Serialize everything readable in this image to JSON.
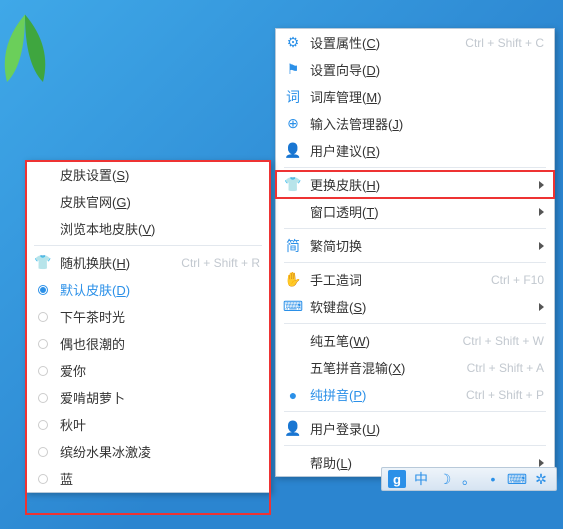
{
  "rightMenu": {
    "groups": [
      [
        {
          "icon": "gear-icon",
          "glyph": "⚙",
          "label": "设置属性(C)",
          "shortcut": "Ctrl + Shift + C"
        },
        {
          "icon": "flag-icon",
          "glyph": "⚑",
          "label": "设置向导(D)"
        },
        {
          "icon": "dict-icon",
          "glyph": "词",
          "label": "词库管理(M)"
        },
        {
          "icon": "globe-icon",
          "glyph": "⊕",
          "label": "输入法管理器(J)"
        },
        {
          "icon": "user-icon",
          "glyph": "👤",
          "label": "用户建议(R)"
        }
      ],
      [
        {
          "icon": "skin-icon",
          "glyph": "👕",
          "label": "更换皮肤(H)",
          "submenu": true,
          "highlight": true
        },
        {
          "icon": "",
          "glyph": "",
          "label": "窗口透明(T)",
          "submenu": true
        }
      ],
      [
        {
          "icon": "simplified-icon",
          "glyph": "简",
          "label": "繁简切换",
          "submenu": true
        }
      ],
      [
        {
          "icon": "hand-icon",
          "glyph": "✋",
          "label": "手工造词",
          "shortcut": "Ctrl + F10"
        },
        {
          "icon": "keyboard-icon",
          "glyph": "⌨",
          "label": "软键盘(S)",
          "submenu": true
        }
      ],
      [
        {
          "icon": "",
          "glyph": "",
          "label": "纯五笔(W)",
          "shortcut": "Ctrl + Shift + W"
        },
        {
          "icon": "",
          "glyph": "",
          "label": "五笔拼音混输(X)",
          "shortcut": "Ctrl + Shift + A"
        },
        {
          "icon": "dot-icon",
          "glyph": "●",
          "label": "纯拼音(P)",
          "shortcut": "Ctrl + Shift + P",
          "selected": true
        }
      ],
      [
        {
          "icon": "user-icon",
          "glyph": "👤",
          "label": "用户登录(U)"
        }
      ],
      [
        {
          "icon": "",
          "glyph": "",
          "label": "帮助(L)",
          "submenu": true
        }
      ]
    ]
  },
  "leftMenu": {
    "groups": [
      [
        {
          "label": "皮肤设置(S)"
        },
        {
          "label": "皮肤官网(G)"
        },
        {
          "label": "浏览本地皮肤(V)"
        }
      ],
      [
        {
          "icon": "skin-icon",
          "glyph": "👕",
          "label": "随机换肤(H)",
          "shortcut": "Ctrl + Shift + R"
        },
        {
          "radio": true,
          "checked": true,
          "label": "默认皮肤(D)",
          "selected": true
        },
        {
          "radio": true,
          "label": "下午茶时光"
        },
        {
          "radio": true,
          "label": "偶也很潮的"
        },
        {
          "radio": true,
          "label": "爱你"
        },
        {
          "radio": true,
          "label": "爱啃胡萝卜"
        },
        {
          "radio": true,
          "label": "秋叶"
        },
        {
          "radio": true,
          "label": "缤纷水果冰激凌"
        },
        {
          "radio": true,
          "label": "蓝"
        }
      ]
    ]
  },
  "taskbar": {
    "items": [
      {
        "name": "g-logo",
        "glyph": "g",
        "cls": "gbox"
      },
      {
        "name": "ime-mode",
        "glyph": "中"
      },
      {
        "name": "moon-icon",
        "glyph": "☽"
      },
      {
        "name": "punct-icon",
        "glyph": "。"
      },
      {
        "name": "user-icon",
        "glyph": "•"
      },
      {
        "name": "keyboard-icon",
        "glyph": "⌨"
      },
      {
        "name": "settings-icon",
        "glyph": "✲"
      }
    ]
  }
}
